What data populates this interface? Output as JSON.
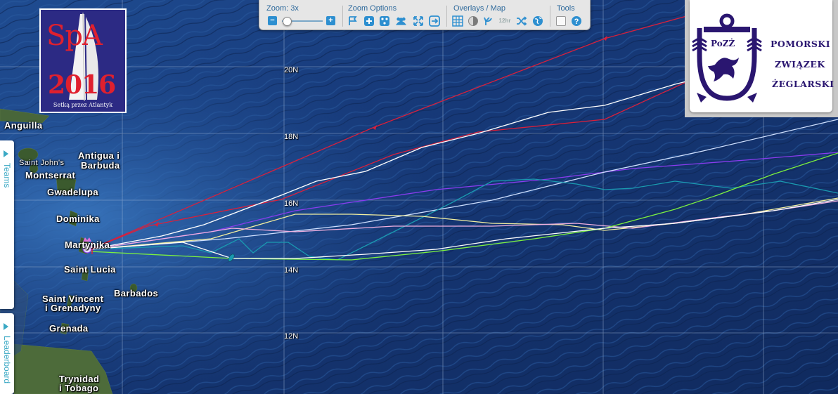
{
  "toolbar": {
    "zoom_label": "Zoom: 3x",
    "zoom_options_label": "Zoom Options",
    "overlays_label": "Overlays / Map",
    "tools_label": "Tools",
    "zoom_minus": "−",
    "zoom_plus": "+",
    "trail_button_label": "12hr"
  },
  "side_tabs": {
    "teams": "Teams",
    "leaderboard": "Leaderboard"
  },
  "spa_logo": {
    "line1": "SpA",
    "line2": "2016",
    "subtitle": "Setką przez Atlantyk"
  },
  "pozz_logo": {
    "badge": "PoZŻ",
    "line1": "POMORSKI",
    "line2": "ZWIĄZEK",
    "line3": "ŻEGLARSKI"
  },
  "latitudes": [
    "20N",
    "18N",
    "16N",
    "14N",
    "12N"
  ],
  "places": [
    {
      "name": "Anguilla"
    },
    {
      "name": "Saint John's"
    },
    {
      "name": "Antigua i"
    },
    {
      "name": "Barbuda"
    },
    {
      "name": "Montserrat"
    },
    {
      "name": "Gwadelupa"
    },
    {
      "name": "Dominika"
    },
    {
      "name": "Martynika"
    },
    {
      "name": "Saint Lucia"
    },
    {
      "name": "Barbados"
    },
    {
      "name": "Saint Vincent"
    },
    {
      "name": "i Grenadyny"
    },
    {
      "name": "Grenada"
    },
    {
      "name": "Trynidad"
    },
    {
      "name": "i Tobago"
    }
  ],
  "colors": {
    "ocean": "#15346f",
    "track_red": "#d8203c",
    "track_white": "#ffffff",
    "track_purple": "#8a3cf0",
    "track_teal": "#1a9ab0",
    "track_yellow": "#f4f0a0",
    "track_green": "#7cf040",
    "track_pink": "#f0b0e0",
    "toolbar_blue": "#2d8fd0"
  }
}
